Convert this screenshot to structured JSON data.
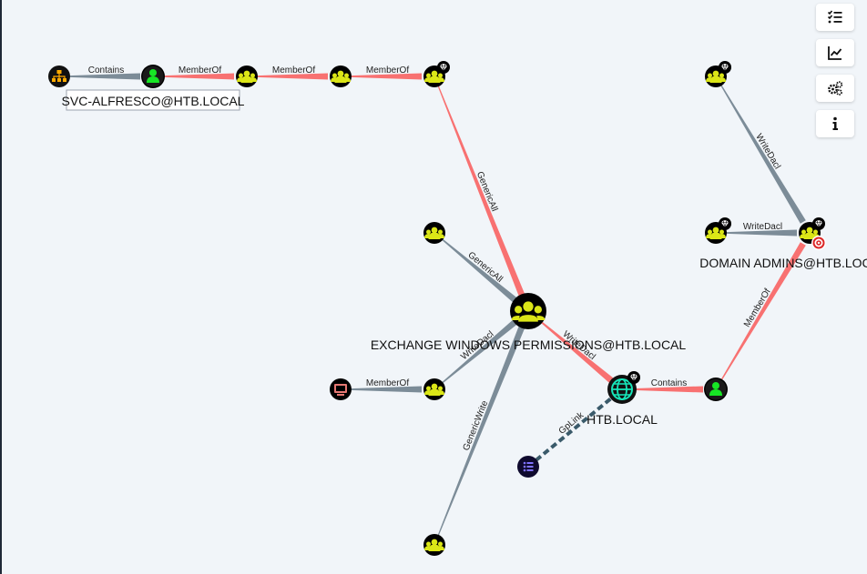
{
  "graph": {
    "nodes": {
      "ou": {
        "type": "ou"
      },
      "svc_user": {
        "type": "user",
        "label": "SVC-ALFRESCO@HTB.LOCAL"
      },
      "group_a": {
        "type": "group"
      },
      "group_b": {
        "type": "group"
      },
      "group_c": {
        "type": "group",
        "highvalue": true
      },
      "group_d": {
        "type": "group"
      },
      "exchange_perms": {
        "type": "group",
        "label": "EXCHANGE WINDOWS PERMISSIONS@HTB.LOCAL"
      },
      "computer": {
        "type": "computer"
      },
      "group_e": {
        "type": "group"
      },
      "gpo": {
        "type": "gpo"
      },
      "group_f": {
        "type": "group"
      },
      "domain": {
        "type": "domain",
        "label": "HTB.LOCAL",
        "highvalue": true
      },
      "admin_user": {
        "type": "user"
      },
      "group_g": {
        "type": "group",
        "highvalue": true
      },
      "group_h": {
        "type": "group",
        "highvalue": true
      },
      "domain_admins": {
        "type": "group",
        "label": "DOMAIN ADMINS@HTB.LOCAL",
        "highvalue": true,
        "target": true
      }
    },
    "edges": [
      {
        "from": "ou",
        "to": "svc_user",
        "label": "Contains",
        "path": false
      },
      {
        "from": "svc_user",
        "to": "group_a",
        "label": "MemberOf",
        "path": true
      },
      {
        "from": "group_a",
        "to": "group_b",
        "label": "MemberOf",
        "path": true
      },
      {
        "from": "group_b",
        "to": "group_c",
        "label": "MemberOf",
        "path": true
      },
      {
        "from": "group_c",
        "to": "exchange_perms",
        "label": "GenericAll",
        "path": true
      },
      {
        "from": "group_d",
        "to": "exchange_perms",
        "label": "GenericAll",
        "path": false
      },
      {
        "from": "group_e",
        "to": "exchange_perms",
        "label": "WriteDacl",
        "path": false
      },
      {
        "from": "group_f",
        "to": "exchange_perms",
        "label": "GenericWrite",
        "path": false
      },
      {
        "from": "computer",
        "to": "group_e",
        "label": "MemberOf",
        "path": false
      },
      {
        "from": "exchange_perms",
        "to": "domain",
        "label": "WriteDacl",
        "path": true
      },
      {
        "from": "gpo",
        "to": "domain",
        "label": "GpLink",
        "path": false,
        "dashed": true
      },
      {
        "from": "domain",
        "to": "admin_user",
        "label": "Contains",
        "path": true
      },
      {
        "from": "admin_user",
        "to": "domain_admins",
        "label": "MemberOf",
        "path": true
      },
      {
        "from": "group_g",
        "to": "domain_admins",
        "label": "WriteDacl",
        "path": false
      },
      {
        "from": "group_h",
        "to": "domain_admins",
        "label": "WriteDacl",
        "path": false
      }
    ]
  },
  "colors": {
    "group": "#dbe617",
    "user": "#17e625",
    "ou": "#e67873",
    "ou_fill": "#ffaa00",
    "computer": "#e67873",
    "gpo": "#7f72fd",
    "domain": "#17e6b9",
    "path_edge": "#f87171",
    "normal_edge": "#7c8c98",
    "gplink_edge": "#3a5a6a"
  },
  "toolbar": [
    {
      "name": "toggle-list-button",
      "icon": "list-check-icon"
    },
    {
      "name": "chart-button",
      "icon": "chart-line-icon"
    },
    {
      "name": "settings-button",
      "icon": "cogs-icon"
    },
    {
      "name": "info-button",
      "icon": "info-icon"
    }
  ]
}
